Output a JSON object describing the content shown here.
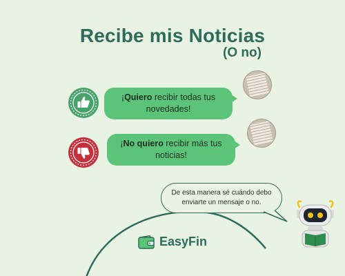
{
  "header": {
    "title": "Recibe mis Noticias",
    "subtitle": "(O no)"
  },
  "options": [
    {
      "icon": "thumbs-up-icon",
      "bold": "Quiero",
      "line1_prefix": "¡",
      "line1_rest": " recibir todas tus",
      "line2": "novedades!"
    },
    {
      "icon": "thumbs-down-icon",
      "bold": "No quiero",
      "line1_prefix": "¡",
      "line1_rest": " recibir más tus",
      "line2": "noticias!"
    }
  ],
  "note": {
    "line1": "De esta manera sé cuándo debo",
    "line2": "enviarte un mensaje o no."
  },
  "brand": {
    "name": "EasyFin"
  },
  "colors": {
    "background": "#e9f3e3",
    "primary": "#2e6b5a",
    "bubble": "#5bc479",
    "like": "#48a36b",
    "dislike": "#c6303a"
  }
}
